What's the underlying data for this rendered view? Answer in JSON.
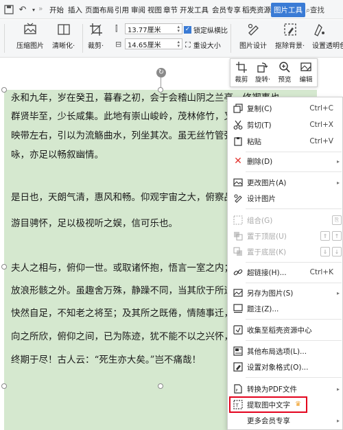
{
  "toolbar_top": {
    "menu": [
      "开始",
      "插入",
      "页面布局",
      "引用",
      "审阅",
      "视图",
      "章节",
      "开发工具",
      "会员专享",
      "稻壳资源"
    ],
    "active_tab": "图片工具",
    "search_label": "查找",
    "more_label": "»"
  },
  "ribbon": {
    "compress": "压缩图片",
    "sharpen": "清晰化·",
    "crop": "裁剪·",
    "height_value": "13.77厘米",
    "width_value": "14.65厘米",
    "lock_ratio": "锁定纵横比",
    "reset_size": "重设大小",
    "design": "图片设计",
    "remove_bg": "抠除背景·",
    "transparent": "设置透明色"
  },
  "document": {
    "lines": [
      "永和九年，岁在癸丑，暮春之初，会于会稽山阴之兰亭，修禊事也。",
      "群贤毕至，少长咸集。此地有崇山峻岭，茂林修竹，又有清流激湍，",
      "映带左右，引以为流觞曲水，列坐其次。虽无丝竹管弦之盛，一觞一",
      "咏，亦足以畅叙幽情。",
      "",
      "是日也，天朗气清，惠风和畅。仰观宇宙之大，俯察品类之盛，所以",
      "游目骋怀，足以极视听之娱，信可乐也。",
      "",
      "夫人之相与，俯仰一世。或取诸怀抱，悟言一室之内；或因寄所托，",
      "放浪形骸之外。虽趣舍万殊，静躁不同，当其欣于所遇，暂得于己，",
      "快然自足，不知老之将至；及其所之既倦，情随事迁，感慨系之矣。",
      "向之所欣，俯仰之间，已为陈迹，犹不能不以之兴怀，况修短随化，",
      "终期于尽！古人云：“死生亦大矣。”岂不痛哉！"
    ]
  },
  "mini_toolbar": {
    "crop": "裁剪",
    "rotate": "旋转·",
    "preview": "预览",
    "edit": "编辑"
  },
  "context_menu": {
    "copy": "复制(C)",
    "copy_sc": "Ctrl+C",
    "cut": "剪切(T)",
    "cut_sc": "Ctrl+X",
    "paste": "粘贴",
    "paste_sc": "Ctrl+V",
    "delete": "删除(D)",
    "change_picture": "更改图片(A)",
    "design_picture": "设计图片",
    "group": "组合(G)",
    "bring_front": "置于顶层(U)",
    "send_back": "置于底层(K)",
    "hyperlink": "超链接(H)...",
    "hyperlink_sc": "Ctrl+K",
    "save_as_picture": "另存为图片(S)",
    "caption": "题注(Z)...",
    "collect": "收集至稻壳资源中心",
    "layout_options": "其他布局选项(L)...",
    "format_object": "设置对象格式(O)...",
    "convert_pdf": "转换为PDF文件",
    "extract_text": "提取图中文字",
    "more_member": "更多会员专享"
  },
  "colors": {
    "image_fill": "#d5e8cf",
    "highlight_border": "#e3001b",
    "active_tab": "#3a7bd5"
  }
}
